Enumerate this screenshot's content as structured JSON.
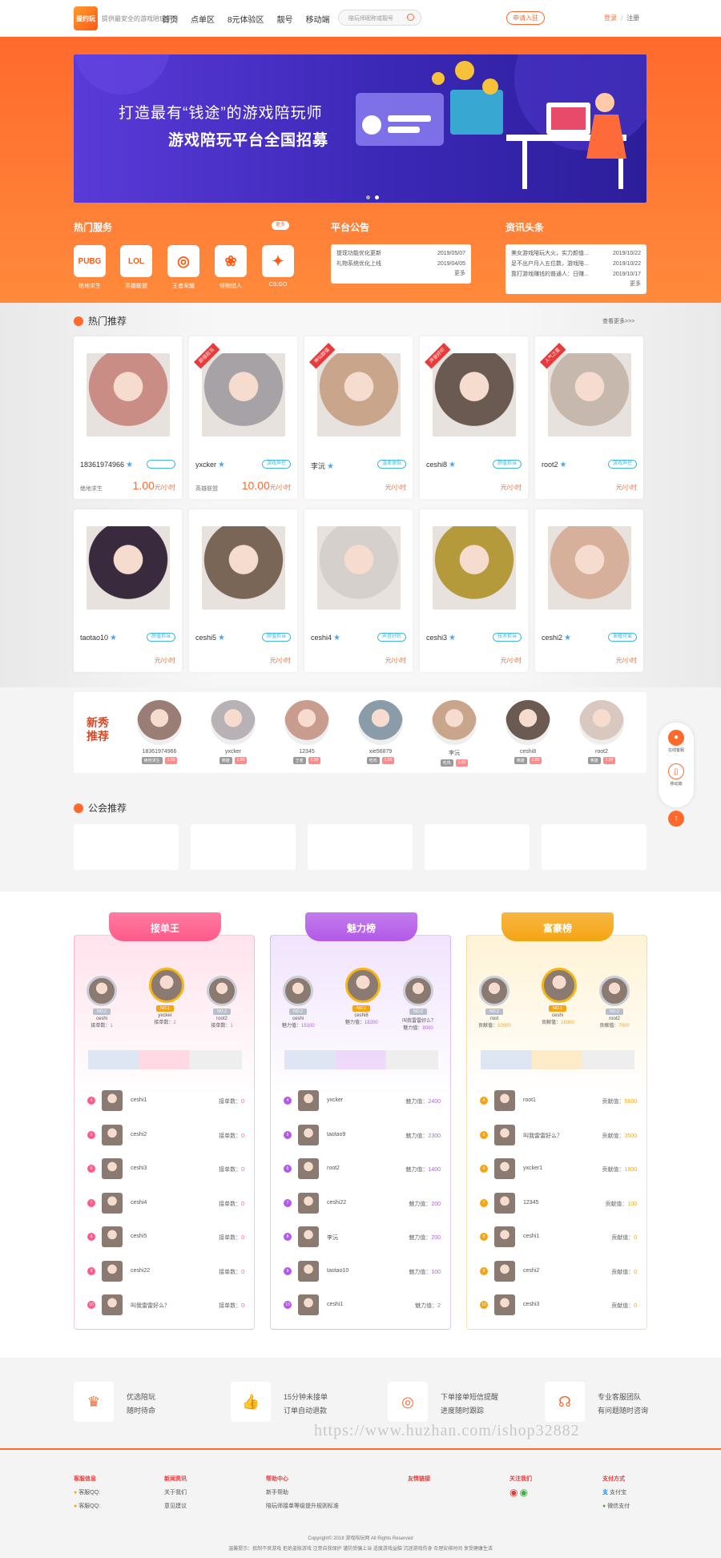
{
  "header": {
    "logo_text": "蛋约玩",
    "logo_sub": "提供最安全的游戏陪玩平台",
    "nav": [
      "首页",
      "点单区",
      "8元体验区",
      "靓号",
      "移动端"
    ],
    "search_placeholder": "陪玩师昵称或靓号",
    "join_label": "申请入驻",
    "login_label": "登录",
    "sep": "/",
    "register_label": "注册"
  },
  "banner": {
    "line1": "打造最有“钱途”的游戏陪玩师",
    "line2": "游戏陪玩平台全国招募"
  },
  "hot_service": {
    "title": "热门服务",
    "more": "更多",
    "games": [
      {
        "icon": "PUBG",
        "name": "绝地求生"
      },
      {
        "icon": "LOL",
        "name": "英雄联盟"
      },
      {
        "icon": "◎",
        "name": "王者荣耀"
      },
      {
        "icon": "❀",
        "name": "怪物猎人"
      },
      {
        "icon": "✦",
        "name": "CS:GO"
      }
    ]
  },
  "announcement": {
    "title": "平台公告",
    "items": [
      {
        "text": "提现功能优化更新",
        "date": "2019/05/07"
      },
      {
        "text": "礼物系统优化上线",
        "date": "2019/04/05"
      }
    ],
    "more": "更多"
  },
  "news": {
    "title": "资讯头条",
    "items": [
      {
        "text": "美女游戏陪玩大火，实力颜值...",
        "date": "2019/10/22"
      },
      {
        "text": "足不出户月入五位数，游戏陪...",
        "date": "2019/10/22"
      },
      {
        "text": "靠打游戏赚钱的普通人：日赚...",
        "date": "2019/10/17"
      }
    ],
    "more": "更多"
  },
  "hot_recommend": {
    "title": "热门推荐",
    "see_all": "查看更多>>>",
    "cards": [
      {
        "name": "18361974966",
        "badge": "",
        "ribbon": "",
        "game": "绝地求生",
        "price": "1.00",
        "unit": "元/小时",
        "color": "#c98d86"
      },
      {
        "name": "yxcker",
        "badge": "游戏声控",
        "ribbon": "颜值担当",
        "game": "英雄联盟",
        "price": "10.00",
        "unit": "元/小时",
        "color": "#a7a2a6"
      },
      {
        "name": "李沅",
        "badge": "温柔体贴",
        "ribbon": "神仙颜值",
        "game": "",
        "price": "",
        "unit": "元/小时",
        "color": "#c8a58b"
      },
      {
        "name": "ceshi8",
        "badge": "颜值担当",
        "ribbon": "声音好听",
        "game": "",
        "price": "",
        "unit": "元/小时",
        "color": "#6b5a52"
      },
      {
        "name": "root2",
        "badge": "游戏声控",
        "ribbon": "人气之星",
        "game": "",
        "price": "",
        "unit": "元/小时",
        "color": "#c7b8ae"
      },
      {
        "name": "taotao10",
        "badge": "颜值担当",
        "ribbon": "",
        "game": "",
        "price": "",
        "unit": "元/小时",
        "color": "#3a2a3e"
      },
      {
        "name": "ceshi5",
        "badge": "颜值担当",
        "ribbon": "",
        "game": "",
        "price": "",
        "unit": "元/小时",
        "color": "#7a6656"
      },
      {
        "name": "ceshi4",
        "badge": "声音好听",
        "ribbon": "",
        "game": "",
        "price": "",
        "unit": "元/小时",
        "color": "#d6d0cc"
      },
      {
        "name": "ceshi3",
        "badge": "技术担当",
        "ribbon": "",
        "game": "",
        "price": "",
        "unit": "元/小时",
        "color": "#b59a3c"
      },
      {
        "name": "ceshi2",
        "badge": "美瞳可爱",
        "ribbon": "",
        "game": "",
        "price": "",
        "unit": "元/小时",
        "color": "#d6b09a"
      }
    ]
  },
  "new_recommend": {
    "title": "新秀推荐",
    "users": [
      {
        "name": "18361974966",
        "tag1": "绝地求生",
        "tag2": "1.00",
        "color": "#9a7e76"
      },
      {
        "name": "yxcker",
        "tag1": "英雄",
        "tag2": "1.00",
        "color": "#b8b2b6"
      },
      {
        "name": "12345",
        "tag1": "王者",
        "tag2": "1.00",
        "color": "#c89c8e"
      },
      {
        "name": "xie56879",
        "tag1": "吃鸡",
        "tag2": "1.00",
        "color": "#8a9caa"
      },
      {
        "name": "李沅",
        "tag1": "吃鸡",
        "tag2": "1.00",
        "color": "#c8a58b"
      },
      {
        "name": "ceshi8",
        "tag1": "英雄",
        "tag2": "1.00",
        "color": "#6b5a52"
      },
      {
        "name": "root2",
        "tag1": "英雄",
        "tag2": "1.00",
        "color": "#d8c8c0"
      }
    ]
  },
  "guild": {
    "title": "公会推荐"
  },
  "ranks": [
    {
      "title": "接单王",
      "color": "#ff5a8a",
      "light": "#ffe3ec",
      "metric": "接单数：",
      "top3": [
        {
          "no": "NO.2",
          "name": "ceshi",
          "value": "1"
        },
        {
          "no": "NO.1",
          "name": "yxcker",
          "value": "2"
        },
        {
          "no": "NO.3",
          "name": "root2",
          "value": "1"
        }
      ],
      "rows": [
        {
          "n": "4",
          "name": "ceshi1",
          "value": "0"
        },
        {
          "n": "5",
          "name": "ceshi2",
          "value": "0"
        },
        {
          "n": "6",
          "name": "ceshi3",
          "value": "0"
        },
        {
          "n": "7",
          "name": "ceshi4",
          "value": "0"
        },
        {
          "n": "8",
          "name": "ceshi5",
          "value": "0"
        },
        {
          "n": "9",
          "name": "ceshi22",
          "value": "0"
        },
        {
          "n": "10",
          "name": "叫我雷雷好么？",
          "value": "0"
        }
      ]
    },
    {
      "title": "魅力榜",
      "color": "#b35ae8",
      "light": "#f1e3fd",
      "metric": "魅力值：",
      "top3": [
        {
          "no": "NO.2",
          "name": "ceshi",
          "value": "15100"
        },
        {
          "no": "NO.1",
          "name": "ceshi8",
          "value": "18200"
        },
        {
          "no": "NO.3",
          "name": "叫我雷雷好么？",
          "value": "8000"
        }
      ],
      "rows": [
        {
          "n": "4",
          "name": "yxcker",
          "value": "2400"
        },
        {
          "n": "5",
          "name": "taotao9",
          "value": "2300"
        },
        {
          "n": "6",
          "name": "root2",
          "value": "1400"
        },
        {
          "n": "7",
          "name": "ceshi22",
          "value": "200"
        },
        {
          "n": "8",
          "name": "李沅",
          "value": "200"
        },
        {
          "n": "9",
          "name": "taotao10",
          "value": "100"
        },
        {
          "n": "10",
          "name": "ceshi1",
          "value": "2"
        }
      ]
    },
    {
      "title": "富豪榜",
      "color": "#f5a514",
      "light": "#fff3d6",
      "metric": "贡献值：",
      "top3": [
        {
          "no": "NO.2",
          "name": "root",
          "value": "10000"
        },
        {
          "no": "NO.1",
          "name": "ceshi",
          "value": "16000"
        },
        {
          "no": "NO.3",
          "name": "root2",
          "value": "7000"
        }
      ],
      "rows": [
        {
          "n": "4",
          "name": "root1",
          "value": "5600"
        },
        {
          "n": "5",
          "name": "叫我雷雷好么？",
          "value": "3500"
        },
        {
          "n": "6",
          "name": "yxcker1",
          "value": "1800"
        },
        {
          "n": "7",
          "name": "12345",
          "value": "100"
        },
        {
          "n": "8",
          "name": "ceshi1",
          "value": "0"
        },
        {
          "n": "9",
          "name": "ceshi2",
          "value": "0"
        },
        {
          "n": "10",
          "name": "ceshi3",
          "value": "0"
        }
      ]
    }
  ],
  "features": [
    {
      "icon": "crown-icon",
      "t1": "优选陪玩",
      "t2": "随时待命"
    },
    {
      "icon": "thumb-icon",
      "t1": "15分钟未接单",
      "t2": "订单自动退款"
    },
    {
      "icon": "target-icon",
      "t1": "下单接单短信提醒",
      "t2": "进度随时跟踪"
    },
    {
      "icon": "headset-icon",
      "t1": "专业客服团队",
      "t2": "有问题随时咨询"
    }
  ],
  "watermark": "https://www.huzhan.com/ishop32882",
  "side": {
    "service": "在线客服",
    "mobile": "移动端"
  },
  "footer": {
    "col1": {
      "h": "客服信息",
      "a": "客服QQ:",
      "b": "客服QQ:"
    },
    "col2": {
      "h": "新闻资讯",
      "a": "关于我们",
      "b": "意见建议"
    },
    "col3": {
      "h": "帮助中心",
      "a": "新手帮助",
      "b": "陪玩师接单等级提升规则标准"
    },
    "col4": {
      "h": "友情链接"
    },
    "col5": {
      "h": "关注我们"
    },
    "col6": {
      "h": "支付方式",
      "a": "支付宝",
      "b": "微信支付"
    },
    "copyright": "Copyright© 2018 游戏陪玩网 All Rights Reserved",
    "warning": "温馨提示：抵制不良游戏 拒绝盗版游戏 注意自我保护 谨防受骗上当 适度游戏益脑 沉迷游戏伤身 合理安排时间 享受健康生活"
  }
}
